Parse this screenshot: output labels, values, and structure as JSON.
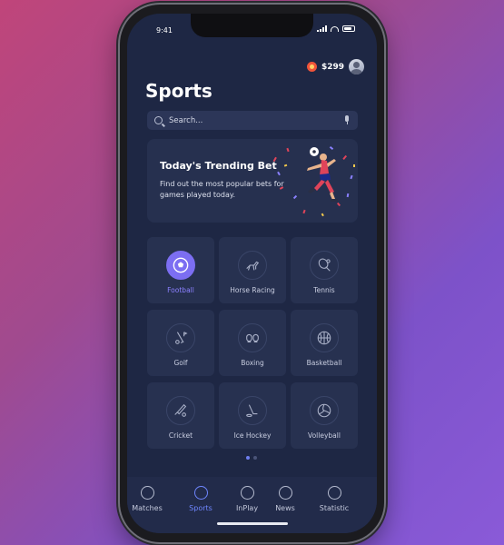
{
  "status_bar": {
    "time": "9:41"
  },
  "header": {
    "balance": "$299",
    "title": "Sports"
  },
  "search": {
    "placeholder": "Search..."
  },
  "banner": {
    "title": "Today's Trending Bet",
    "text": "Find out the most popular bets for games played today."
  },
  "sports": [
    {
      "label": "Football",
      "icon": "football-icon",
      "active": true
    },
    {
      "label": "Horse Racing",
      "icon": "horse-icon",
      "active": false
    },
    {
      "label": "Tennis",
      "icon": "tennis-icon",
      "active": false
    },
    {
      "label": "Golf",
      "icon": "golf-icon",
      "active": false
    },
    {
      "label": "Boxing",
      "icon": "boxing-icon",
      "active": false
    },
    {
      "label": "Basketball",
      "icon": "basketball-icon",
      "active": false
    },
    {
      "label": "Cricket",
      "icon": "cricket-icon",
      "active": false
    },
    {
      "label": "Ice Hockey",
      "icon": "ice-hockey-icon",
      "active": false
    },
    {
      "label": "Volleyball",
      "icon": "volleyball-icon",
      "active": false
    }
  ],
  "pagination": {
    "pages": 2,
    "current": 1
  },
  "nav": [
    {
      "label": "Matches",
      "icon": "matches-icon",
      "active": false
    },
    {
      "label": "Sports",
      "icon": "sports-icon",
      "active": true
    },
    {
      "label": "InPlay",
      "icon": "inplay-icon",
      "active": false
    },
    {
      "label": "News",
      "icon": "news-icon",
      "active": false
    },
    {
      "label": "Statistic",
      "icon": "statistic-icon",
      "active": false
    }
  ],
  "colors": {
    "background": "#1e2744",
    "card": "#273150",
    "accent": "#7c6ef2",
    "nav_active": "#6f86ff"
  }
}
